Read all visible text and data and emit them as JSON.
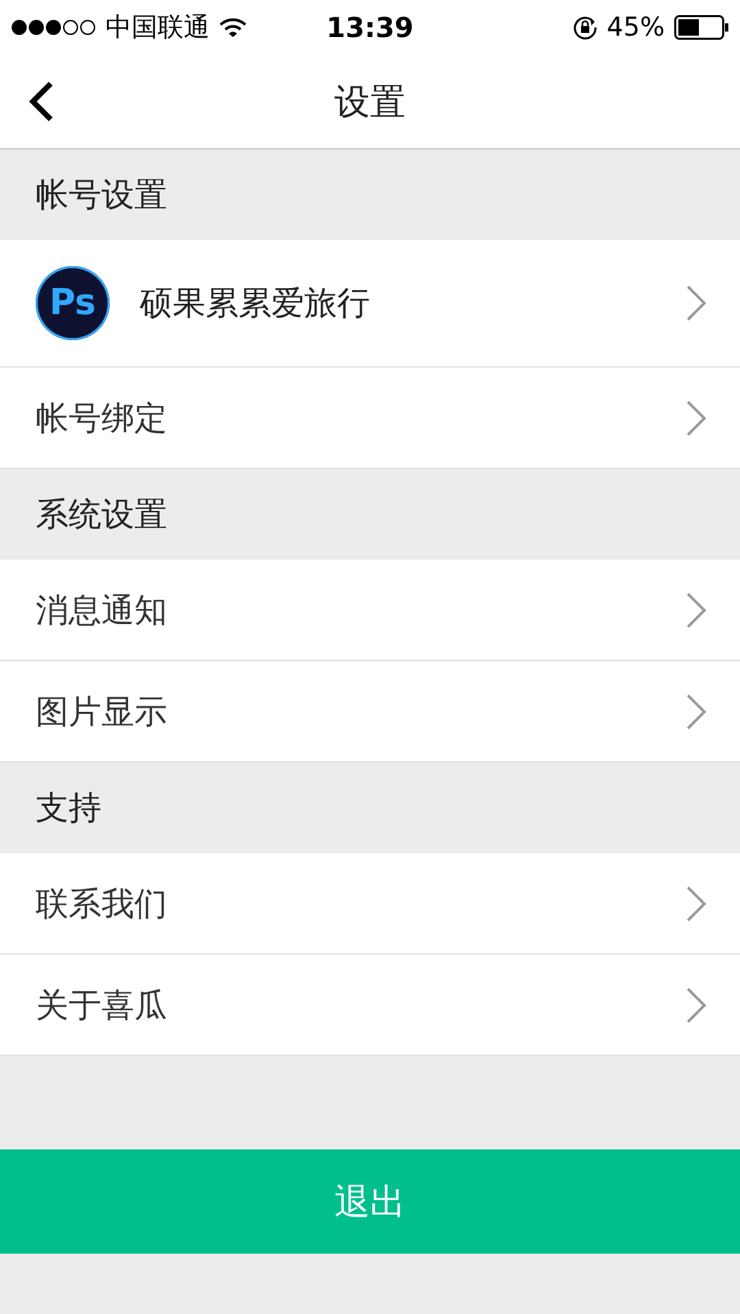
{
  "status_bar": {
    "carrier": "中国联通",
    "time": "13:39",
    "battery": "45%"
  },
  "nav": {
    "title": "设置"
  },
  "sections": [
    {
      "title": "帐号设置",
      "items": [
        {
          "kind": "profile",
          "label": "硕果累累爱旅行",
          "avatar_text": "Ps"
        },
        {
          "kind": "link",
          "label": "帐号绑定"
        }
      ]
    },
    {
      "title": "系统设置",
      "items": [
        {
          "kind": "link",
          "label": "消息通知"
        },
        {
          "kind": "link",
          "label": "图片显示"
        }
      ]
    },
    {
      "title": "支持",
      "items": [
        {
          "kind": "link",
          "label": "联系我们"
        },
        {
          "kind": "link",
          "label": "关于喜瓜"
        }
      ]
    }
  ],
  "logout_button": "退出"
}
